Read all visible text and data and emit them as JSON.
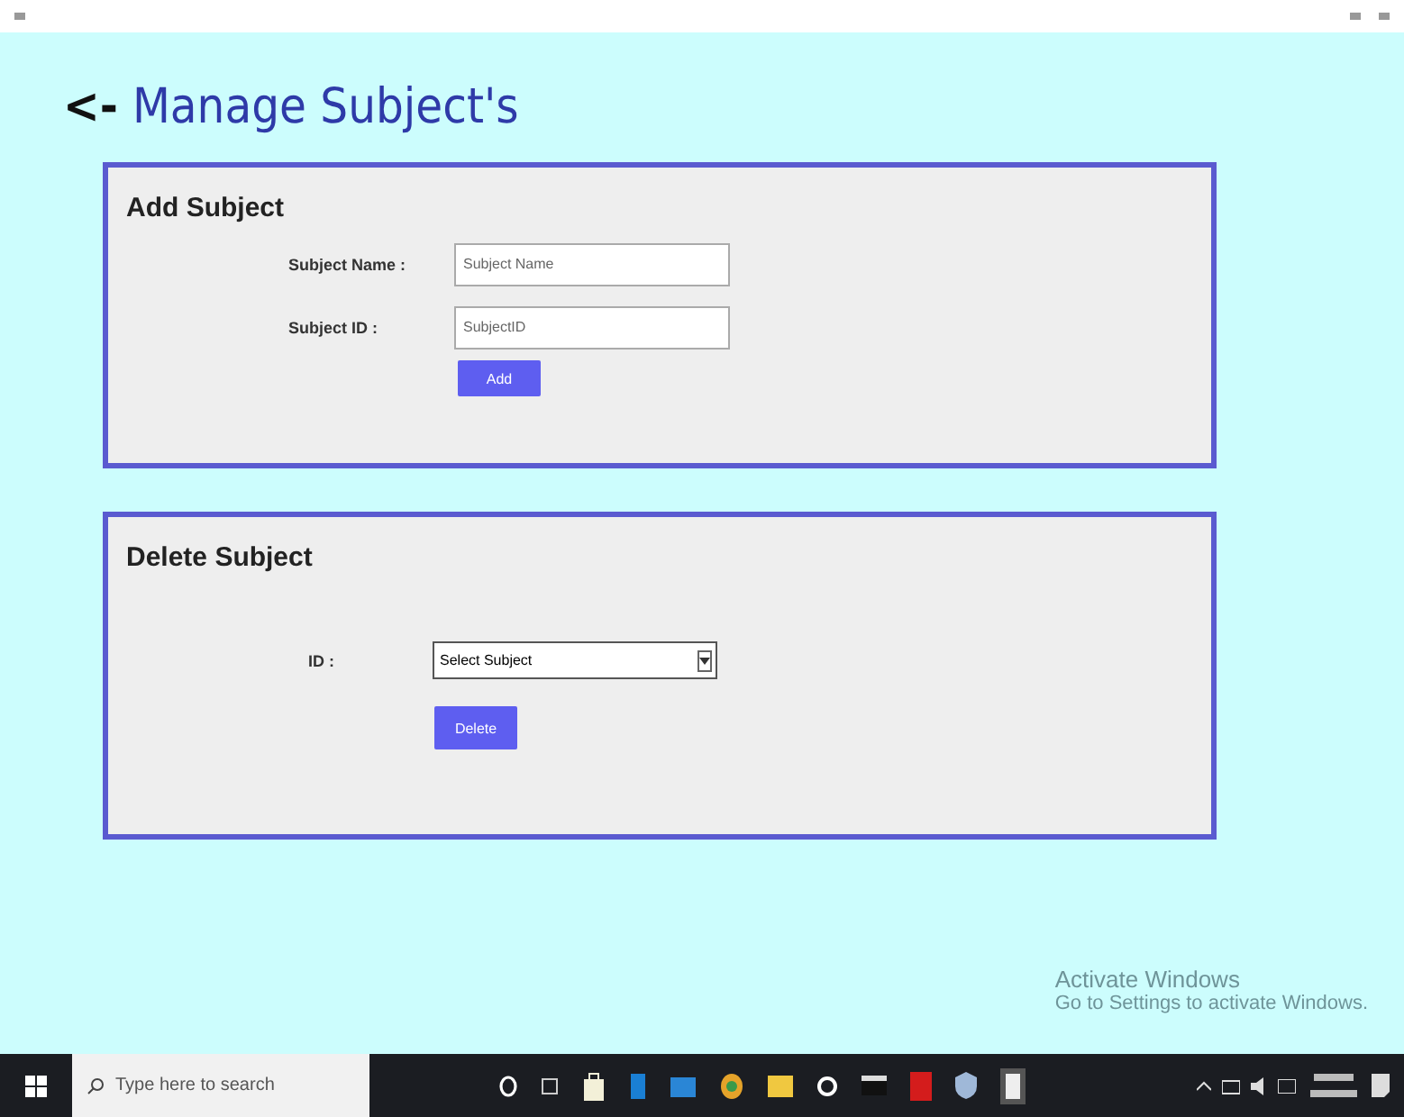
{
  "page": {
    "back": "<-",
    "title": "Manage Subject's"
  },
  "add_subject": {
    "heading": "Add Subject",
    "fields": [
      {
        "label": "Subject Name :",
        "placeholder": "Subject Name"
      },
      {
        "label": "Subject ID :",
        "placeholder": "SubjectID"
      }
    ],
    "button": "Add"
  },
  "delete_subject": {
    "heading": "Delete Subject",
    "label": "ID :",
    "select": "Select Subject",
    "button": "Delete"
  },
  "overlay": {
    "title": "Activate Windows",
    "subtitle": "Go to Settings to activate Windows."
  },
  "taskbar": {
    "search_placeholder": "Type here to search"
  }
}
